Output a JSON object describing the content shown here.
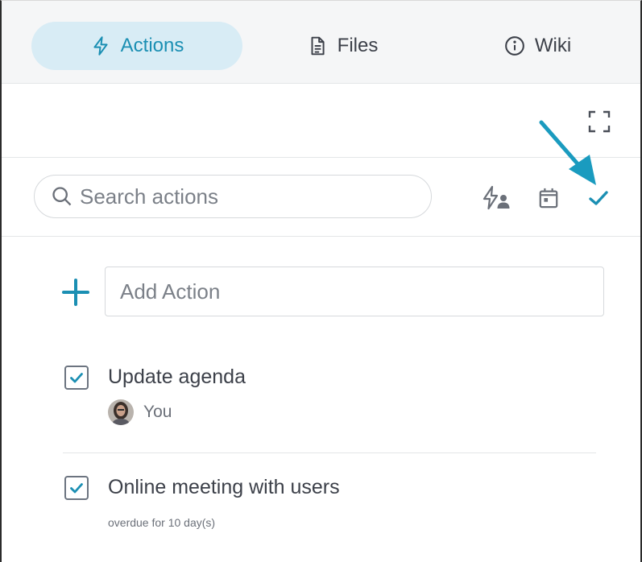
{
  "tabs": [
    {
      "label": "Actions",
      "icon": "lightning-icon",
      "active": true
    },
    {
      "label": "Files",
      "icon": "document-icon",
      "active": false
    },
    {
      "label": "Wiki",
      "icon": "info-icon",
      "active": false
    }
  ],
  "toolbar": {
    "expand_icon": "fullscreen-icon"
  },
  "search": {
    "placeholder": "Search actions",
    "filters": [
      {
        "name": "assigned-to-me",
        "icon": "lightning-person-icon"
      },
      {
        "name": "due-date",
        "icon": "calendar-icon"
      },
      {
        "name": "completed",
        "icon": "checkmark-icon"
      }
    ]
  },
  "add_action": {
    "placeholder": "Add Action"
  },
  "actions": [
    {
      "title": "Update agenda",
      "checked": true,
      "assignee": "You"
    },
    {
      "title": "Online meeting with users",
      "checked": true,
      "status": "overdue for 10 day(s)"
    }
  ],
  "colors": {
    "accent": "#1b8fb3",
    "active_tab_bg": "#d8ecf5",
    "arrow": "#1a9bbf"
  }
}
